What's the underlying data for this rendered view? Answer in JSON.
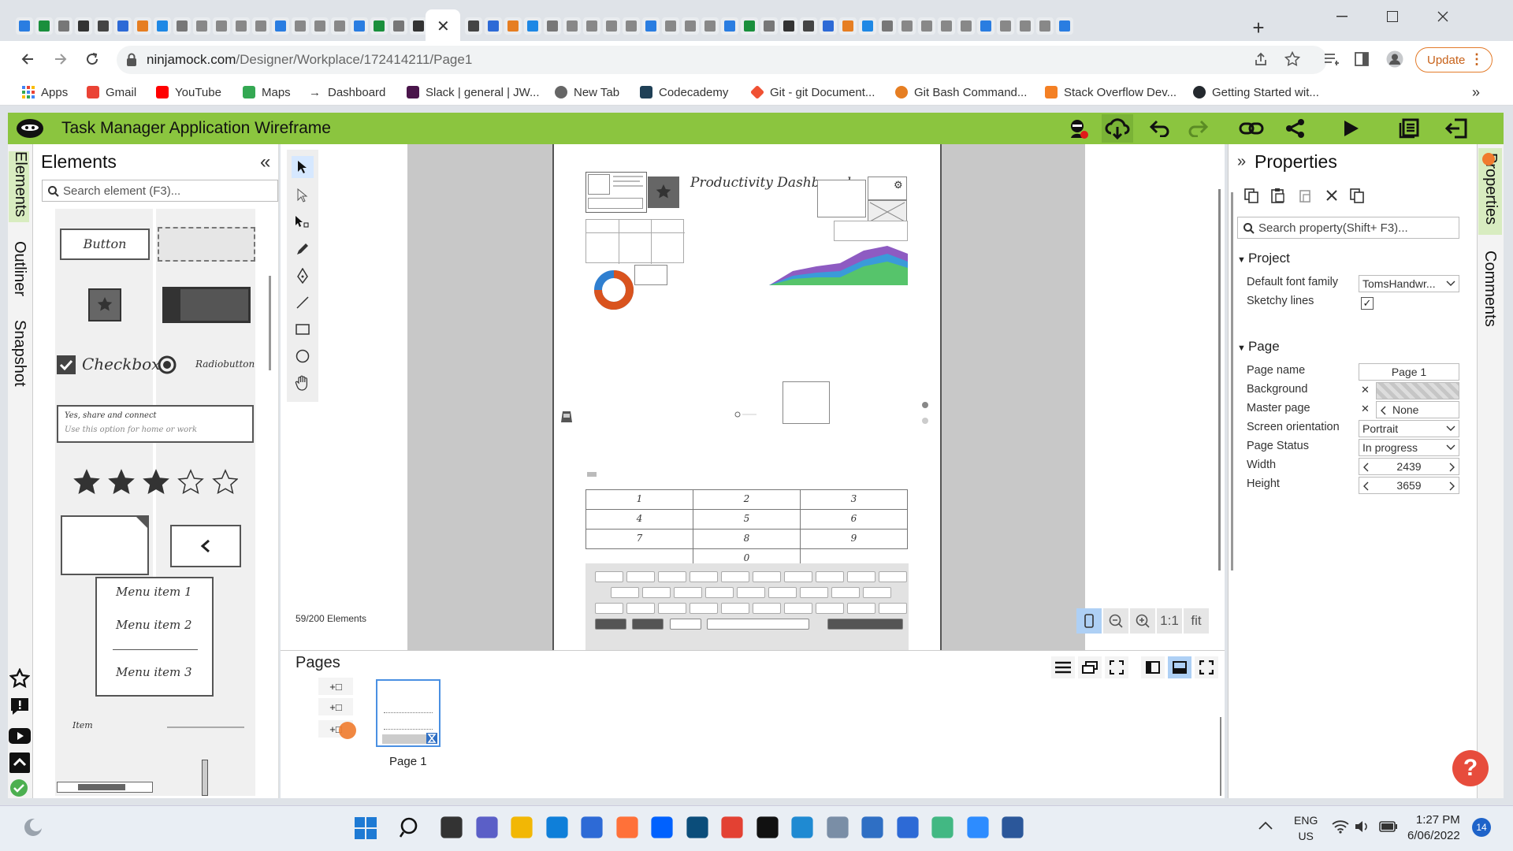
{
  "browser": {
    "url": "ninjamock.com/Designer/Workplace/172414211/Page1",
    "url_host": "ninjamock.com",
    "url_path": "/Designer/Workplace/172414211/Page1",
    "update_label": "Update",
    "new_tab_symbol": "+",
    "bookmarks": [
      "Apps",
      "Gmail",
      "YouTube",
      "Maps",
      "Dashboard",
      "Slack | general | JW...",
      "New Tab",
      "Codecademy",
      "Git - git Document...",
      "Git Bash Command...",
      "Stack Overflow Dev...",
      "Getting Started wit..."
    ],
    "bookmarks_overflow": "»"
  },
  "app": {
    "title": "Task Manager Application Wireframe",
    "accent": "#8bc53f"
  },
  "left_tabs": [
    "Elements",
    "Outliner",
    "Snapshot"
  ],
  "elements_panel": {
    "title": "Elements",
    "collapse_symbol": "«",
    "search_placeholder": "Search element (F3)...",
    "items": {
      "button": "Button",
      "checkbox": "Checkbox",
      "radiobutton": "Radiobutton",
      "textbox_line1": "Yes, share and connect",
      "textbox_line2": "Use this option for home or work",
      "menu_items": [
        "Menu item 1",
        "Menu item 2",
        "Menu item 3"
      ],
      "item_label": "Item"
    }
  },
  "canvas": {
    "element_count": "59/200 Elements",
    "page_heading": "Productivity Dashboard",
    "keypad": [
      "1",
      "2",
      "3",
      "4",
      "5",
      "6",
      "7",
      "8",
      "9",
      "0"
    ],
    "zoom_one_to_one": "1:1",
    "zoom_fit": "fit"
  },
  "pages": {
    "title": "Pages",
    "add_symbol": "+□",
    "thumbnail_label": "Page 1"
  },
  "properties": {
    "title": "Properties",
    "expand_symbol": "»",
    "search_placeholder": "Search property(Shift+ F3)...",
    "project_section": "Project",
    "page_section": "Page",
    "project_fields": [
      {
        "label": "Default font family",
        "value": "TomsHandwr..."
      },
      {
        "label": "Sketchy lines",
        "value": "✓"
      }
    ],
    "page_fields": [
      {
        "label": "Page name",
        "value": "Page 1"
      },
      {
        "label": "Background",
        "value": ""
      },
      {
        "label": "Master page",
        "value": "None"
      },
      {
        "label": "Screen orientation",
        "value": "Portrait"
      },
      {
        "label": "Page Status",
        "value": "In progress"
      },
      {
        "label": "Width",
        "value": "2439"
      },
      {
        "label": "Height",
        "value": "3659"
      }
    ]
  },
  "right_tabs": [
    "Properties",
    "Comments"
  ],
  "help_symbol": "?",
  "taskbar": {
    "language": "ENG",
    "region": "US",
    "time": "1:27 PM",
    "date": "6/06/2022",
    "notification_count": "14"
  }
}
